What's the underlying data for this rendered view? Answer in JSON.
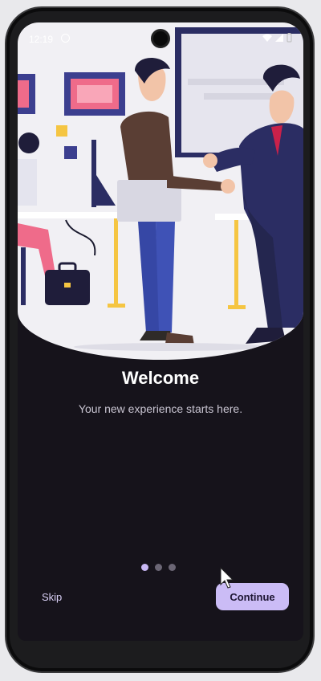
{
  "status_bar": {
    "time": "12:19"
  },
  "onboarding": {
    "title": "Welcome",
    "subtitle": "Your new experience starts here.",
    "pager": {
      "page_count": 3,
      "current_page": 1
    },
    "skip_label": "Skip",
    "continue_label": "Continue"
  },
  "icons": [
    "app-notification-icon",
    "wifi-icon",
    "signal-icon",
    "battery-icon",
    "mouse-cursor-icon"
  ],
  "colors": {
    "screen_background": "#16131b",
    "hero_background": "#f1f0f4",
    "accent": "#cbbcf6",
    "active_dot": "#c9b8f5",
    "inactive_dot": "#6b6675"
  }
}
